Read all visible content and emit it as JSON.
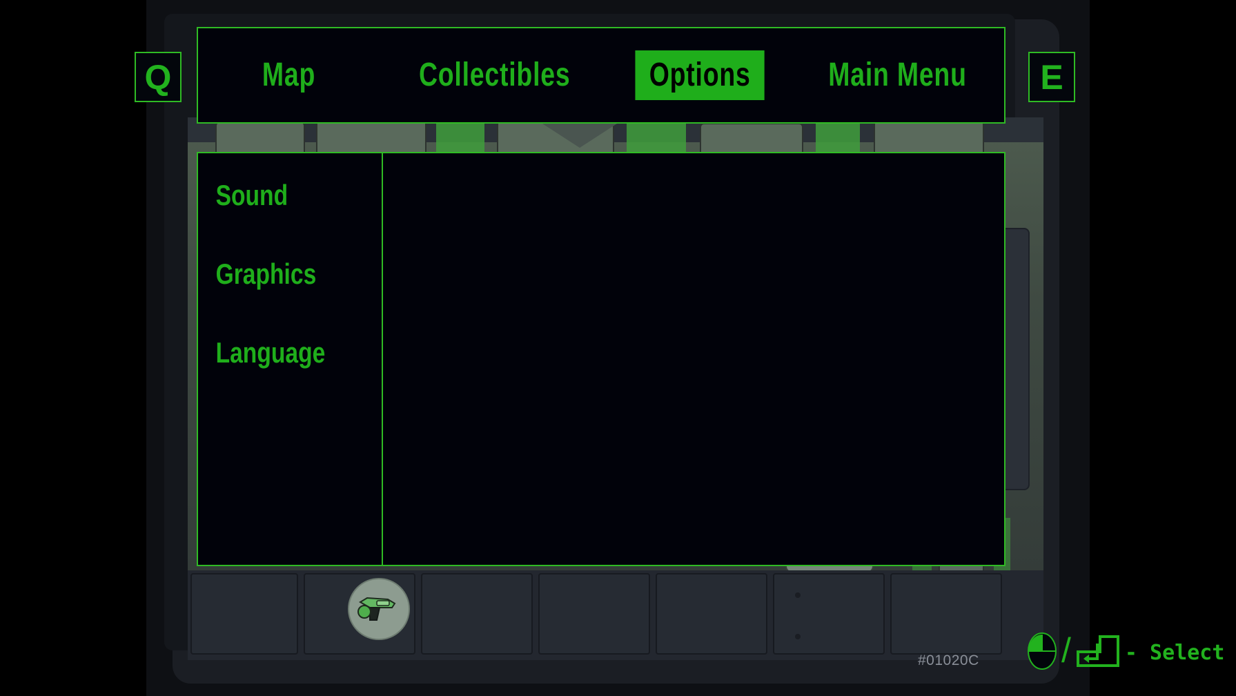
{
  "window": {
    "title": "Pause Menu"
  },
  "key_hints": {
    "prev_key": "Q",
    "next_key": "E"
  },
  "tabs": [
    {
      "label": "Map",
      "active": false,
      "name": "tab-map"
    },
    {
      "label": "Collectibles",
      "active": false,
      "name": "tab-collectibles"
    },
    {
      "label": "Options",
      "active": true,
      "name": "tab-options"
    },
    {
      "label": "Main Menu",
      "active": false,
      "name": "tab-main-menu"
    }
  ],
  "options": {
    "categories": [
      {
        "label": "Sound",
        "selected": false
      },
      {
        "label": "Graphics",
        "selected": false
      },
      {
        "label": "Language",
        "selected": false
      }
    ],
    "detail_pane_content": ""
  },
  "status": {
    "build_id": "#01020C"
  },
  "input_hint": {
    "mouse_icon": "mouse-left-click-icon",
    "separator": "/",
    "key_icon": "enter-key-icon",
    "action_label": "- Select"
  },
  "hud": {
    "equipped_item_icon": "pistol-icon"
  },
  "colors": {
    "accent_green": "#2fbb24",
    "text_green": "#1fae1b",
    "panel_black": "#01020a",
    "screen_black": "#000000",
    "version_gray": "#8a8f98",
    "world_wall": "#4e5c4f",
    "world_floor": "#23272f"
  }
}
